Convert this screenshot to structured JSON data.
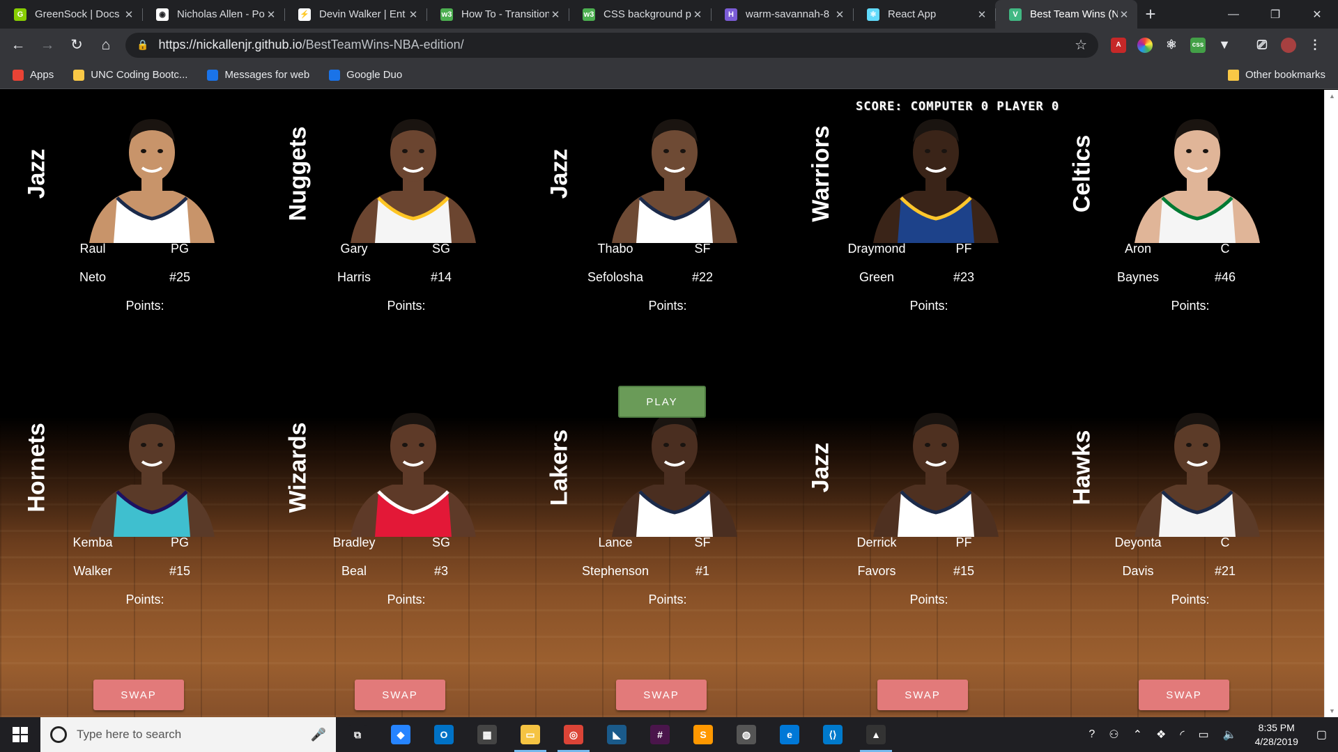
{
  "browser": {
    "tabs": [
      {
        "title": "GreenSock | Docs |",
        "favicon_color": "#88ce02",
        "favicon_glyph": "G"
      },
      {
        "title": "Nicholas Allen - Po",
        "favicon_color": "#ffffff",
        "favicon_glyph": "◉"
      },
      {
        "title": "Devin Walker | Ent",
        "favicon_color": "#ffffff",
        "favicon_glyph": "⚡"
      },
      {
        "title": "How To - Transition",
        "favicon_color": "#4caf50",
        "favicon_glyph": "w3"
      },
      {
        "title": "CSS background p",
        "favicon_color": "#4caf50",
        "favicon_glyph": "w3"
      },
      {
        "title": "warm-savannah-8",
        "favicon_color": "#7b5cd6",
        "favicon_glyph": "H"
      },
      {
        "title": "React App",
        "favicon_color": "#61dafb",
        "favicon_glyph": "⚛"
      },
      {
        "title": "Best Team Wins (N",
        "favicon_color": "#41b883",
        "favicon_glyph": "V"
      }
    ],
    "url_host": "https://nickallenjr.github.io",
    "url_path": "/BestTeamWins-NBA-edition/",
    "bookmarks": [
      {
        "label": "Apps",
        "color": "#ea4335"
      },
      {
        "label": "UNC Coding Bootc...",
        "color": "#f9c846"
      },
      {
        "label": "Messages for web",
        "color": "#1a73e8"
      },
      {
        "label": "Google Duo",
        "color": "#1a73e8"
      }
    ],
    "other_bookmarks": "Other bookmarks"
  },
  "game": {
    "score_text": "SCORE: COMPUTER 0 PLAYER 0",
    "play_label": "PLAY",
    "swap_label": "SWAP",
    "points_label": "Points:",
    "computer_players": [
      {
        "team": "Jazz",
        "first": "Raul",
        "last": "Neto",
        "pos": "PG",
        "number": "#25",
        "jersey": "#ffffff",
        "trim": "#1b2a4a",
        "skin": "#c8946a"
      },
      {
        "team": "Nuggets",
        "first": "Gary",
        "last": "Harris",
        "pos": "SG",
        "number": "#14",
        "jersey": "#f5f5f5",
        "trim": "#fec524",
        "skin": "#6b4530"
      },
      {
        "team": "Jazz",
        "first": "Thabo",
        "last": "Sefolosha",
        "pos": "SF",
        "number": "#22",
        "jersey": "#ffffff",
        "trim": "#1b2a4a",
        "skin": "#6e4a34"
      },
      {
        "team": "Warriors",
        "first": "Draymond",
        "last": "Green",
        "pos": "PF",
        "number": "#23",
        "jersey": "#1d428a",
        "trim": "#ffc72c",
        "skin": "#3a2418"
      },
      {
        "team": "Celtics",
        "first": "Aron",
        "last": "Baynes",
        "pos": "C",
        "number": "#46",
        "jersey": "#f5f5f5",
        "trim": "#007a33",
        "skin": "#e0b598"
      }
    ],
    "player_players": [
      {
        "team": "Hornets",
        "first": "Kemba",
        "last": "Walker",
        "pos": "PG",
        "number": "#15",
        "jersey": "#3fbfcf",
        "trim": "#1d1160",
        "skin": "#5a3a28"
      },
      {
        "team": "Wizards",
        "first": "Bradley",
        "last": "Beal",
        "pos": "SG",
        "number": "#3",
        "jersey": "#e31837",
        "trim": "#ffffff",
        "skin": "#5e3a28"
      },
      {
        "team": "Lakers",
        "first": "Lance",
        "last": "Stephenson",
        "pos": "SF",
        "number": "#1",
        "jersey": "#ffffff",
        "trim": "#1b2a4a",
        "skin": "#4a2e20"
      },
      {
        "team": "Jazz",
        "first": "Derrick",
        "last": "Favors",
        "pos": "PF",
        "number": "#15",
        "jersey": "#ffffff",
        "trim": "#1b2a4a",
        "skin": "#4e3020"
      },
      {
        "team": "Hawks",
        "first": "Deyonta",
        "last": "Davis",
        "pos": "C",
        "number": "#21",
        "jersey": "#f5f5f5",
        "trim": "#1b2a4a",
        "skin": "#5c3b28"
      }
    ]
  },
  "taskbar": {
    "search_placeholder": "Type here to search",
    "apps": [
      {
        "name": "task-view",
        "color": "#1f1f23",
        "glyph": "⧉",
        "open": false
      },
      {
        "name": "sourcetree",
        "color": "#2684ff",
        "glyph": "◆",
        "open": false
      },
      {
        "name": "outlook",
        "color": "#0072c6",
        "glyph": "O",
        "open": false
      },
      {
        "name": "store",
        "color": "#444",
        "glyph": "▦",
        "open": false
      },
      {
        "name": "file-explorer",
        "color": "#f5c342",
        "glyph": "▭",
        "open": true
      },
      {
        "name": "chrome",
        "color": "#db4437",
        "glyph": "◎",
        "open": true
      },
      {
        "name": "mysql-workbench",
        "color": "#1a5a8a",
        "glyph": "◣",
        "open": false
      },
      {
        "name": "slack",
        "color": "#4a154b",
        "glyph": "#",
        "open": false
      },
      {
        "name": "sublime",
        "color": "#ff9800",
        "glyph": "S",
        "open": false
      },
      {
        "name": "github-desktop",
        "color": "#555",
        "glyph": "◍",
        "open": false
      },
      {
        "name": "edge",
        "color": "#0078d7",
        "glyph": "e",
        "open": false
      },
      {
        "name": "vscode",
        "color": "#007acc",
        "glyph": "⟨⟩",
        "open": false
      },
      {
        "name": "photos",
        "color": "#333",
        "glyph": "▲",
        "open": true
      }
    ],
    "time": "8:35 PM",
    "date": "4/28/2019"
  }
}
